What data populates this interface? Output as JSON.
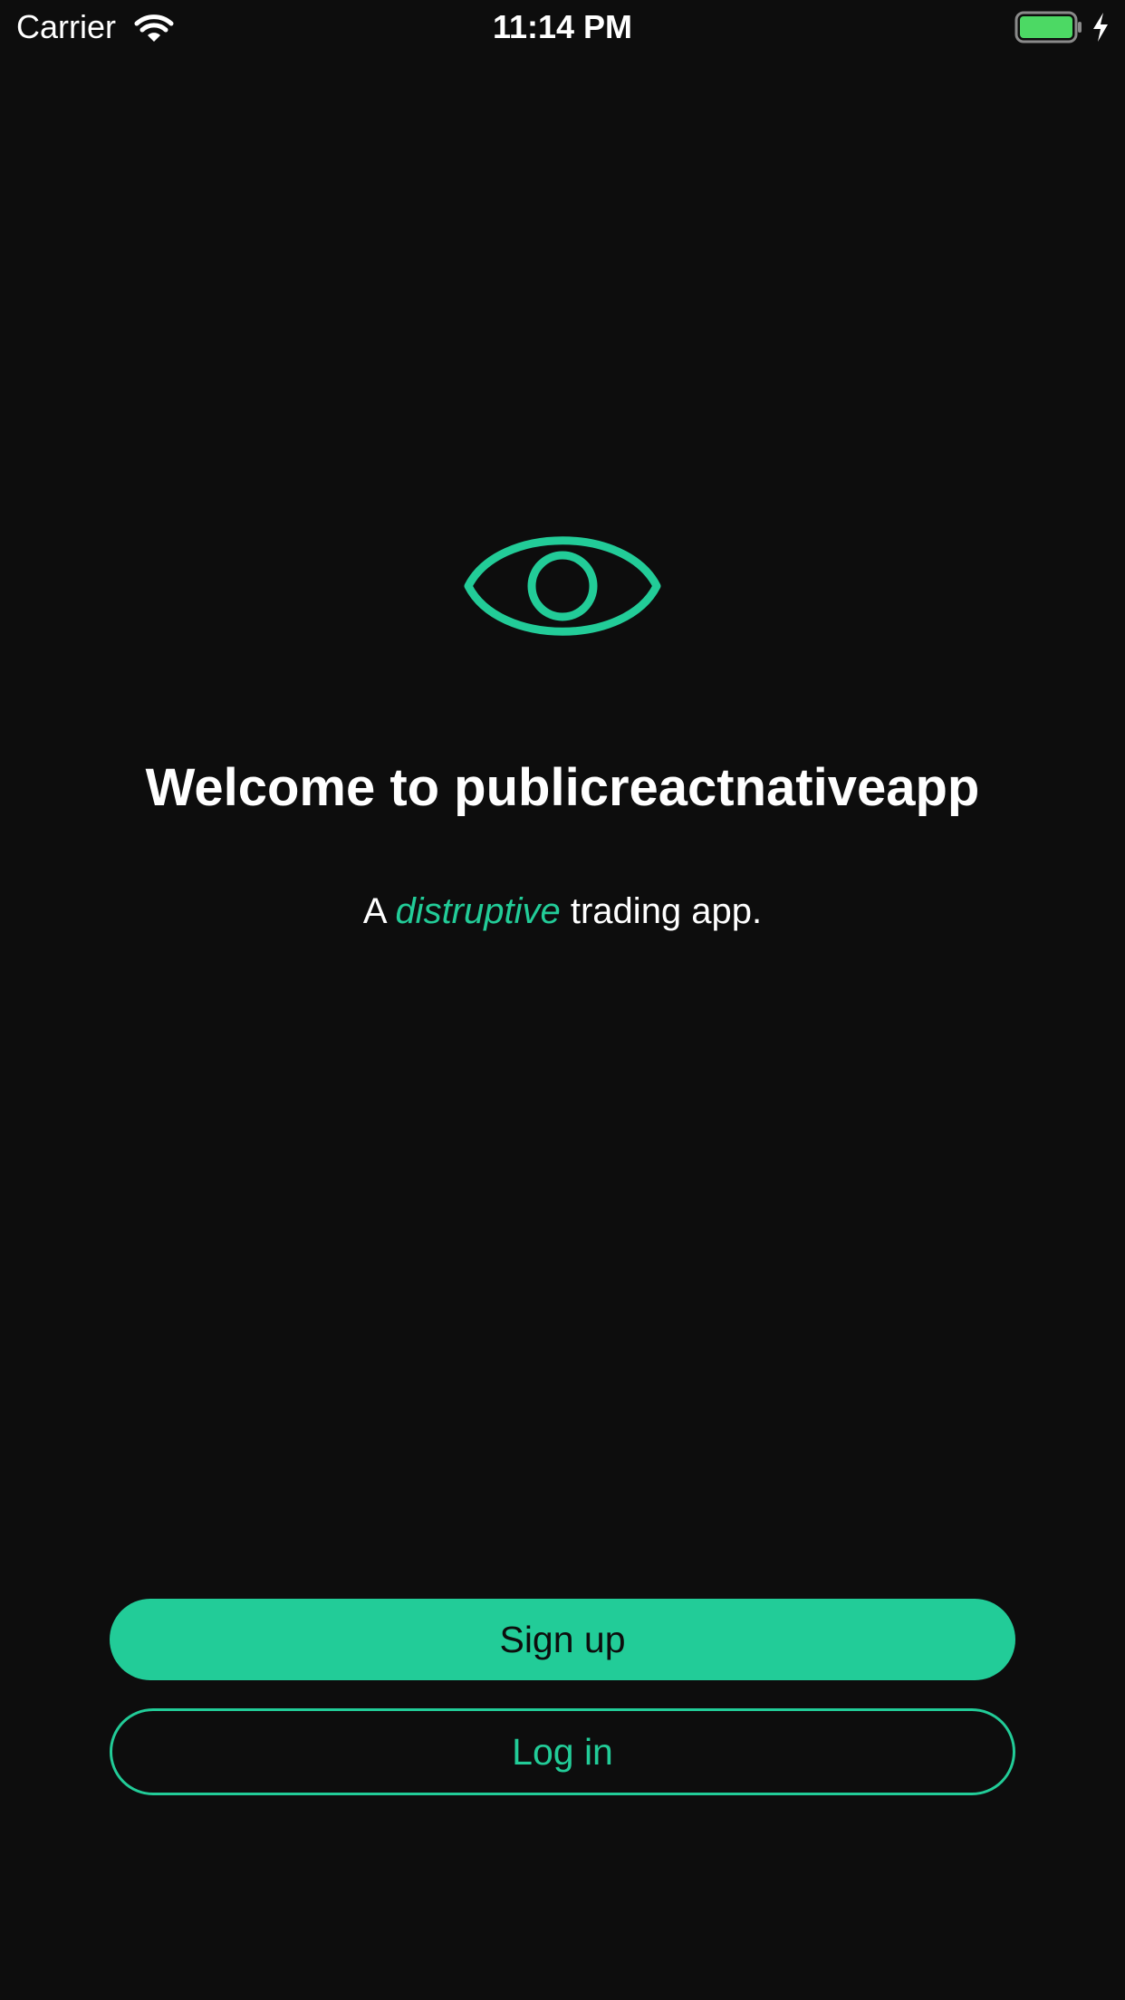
{
  "status_bar": {
    "carrier": "Carrier",
    "time": "11:14 PM",
    "battery_color": "#4cd964"
  },
  "welcome": {
    "logo_icon": "eye-icon",
    "title": "Welcome to publicreactnativeapp",
    "subtitle_prefix": "A",
    "subtitle_accent": "distruptive",
    "subtitle_suffix": "trading app."
  },
  "actions": {
    "signup_label": "Sign up",
    "login_label": "Log in"
  },
  "colors": {
    "background": "#0d0d0d",
    "accent": "#22cc98",
    "text": "#ffffff"
  }
}
